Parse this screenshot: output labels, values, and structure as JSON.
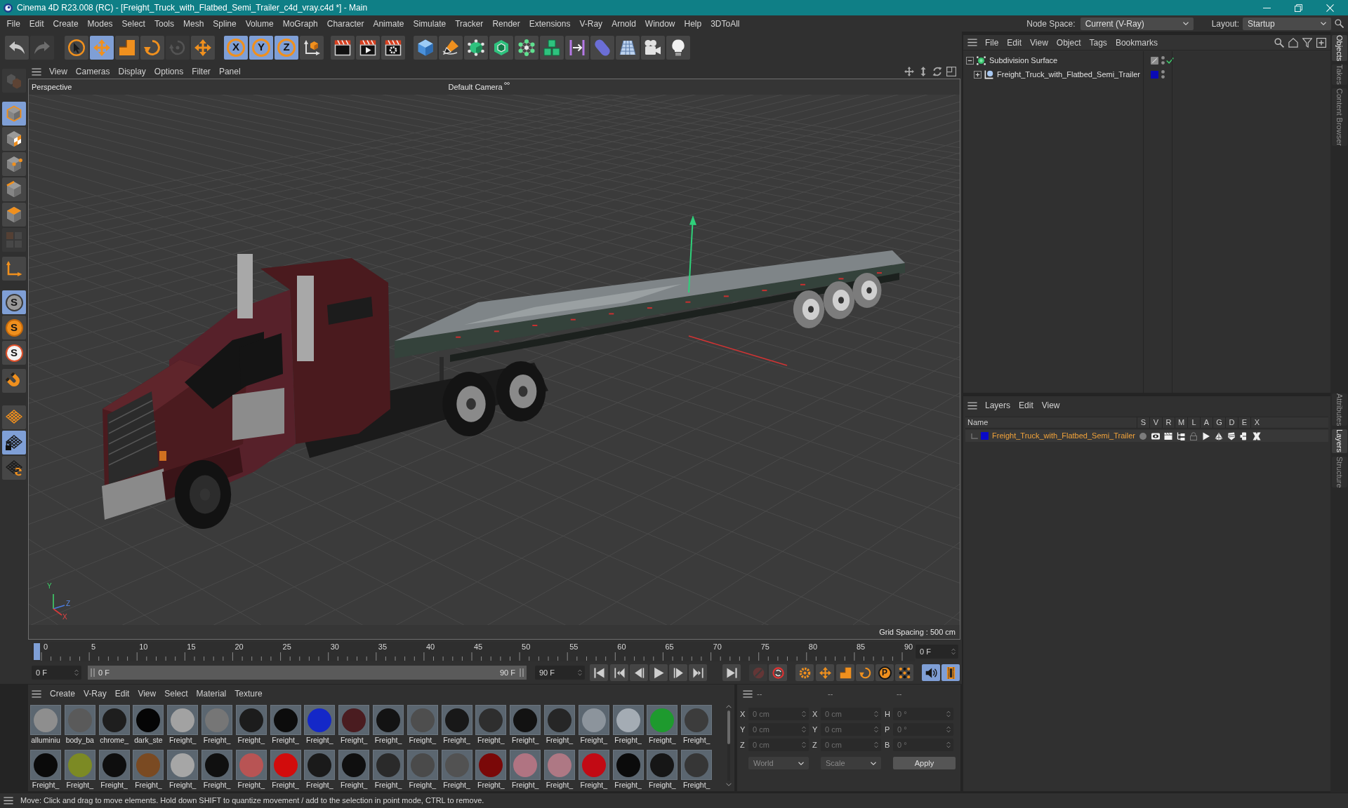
{
  "window": {
    "title": "Cinema 4D R23.008 (RC) - [Freight_Truck_with_Flatbed_Semi_Trailer_c4d_vray.c4d *] - Main"
  },
  "menu_bar": {
    "items": [
      "File",
      "Edit",
      "Create",
      "Modes",
      "Select",
      "Tools",
      "Mesh",
      "Spline",
      "Volume",
      "MoGraph",
      "Character",
      "Animate",
      "Simulate",
      "Tracker",
      "Render",
      "Extensions",
      "V-Ray",
      "Arnold",
      "Window",
      "Help",
      "3DToAll"
    ],
    "node_space": {
      "label": "Node Space:",
      "value": "Current (V-Ray)"
    },
    "layout": {
      "label": "Layout:",
      "value": "Startup"
    }
  },
  "toolbar": {
    "buttons": [
      {
        "selected": false,
        "disabled": false
      },
      {
        "selected": false,
        "disabled": true
      },
      {
        "selected": false,
        "disabled": false
      },
      {
        "selected": true,
        "disabled": false
      },
      {
        "selected": false,
        "disabled": false
      },
      {
        "selected": false,
        "disabled": false
      },
      {
        "selected": false,
        "disabled": true
      },
      {
        "selected": false,
        "disabled": false
      },
      {
        "label": "X",
        "selected": true,
        "disabled": false
      },
      {
        "label": "Y",
        "selected": true,
        "disabled": false
      },
      {
        "label": "Z",
        "selected": true,
        "disabled": false
      },
      {
        "selected": false,
        "disabled": false
      },
      {
        "selected": false,
        "disabled": false
      },
      {
        "selected": false,
        "disabled": false
      },
      {
        "selected": false,
        "disabled": false
      },
      {
        "selected": false,
        "disabled": false
      },
      {
        "selected": false,
        "disabled": false
      },
      {
        "selected": false,
        "disabled": false
      },
      {
        "selected": false,
        "disabled": false
      },
      {
        "selected": false,
        "disabled": false
      },
      {
        "selected": false,
        "disabled": false
      },
      {
        "selected": false,
        "disabled": false
      },
      {
        "selected": false,
        "disabled": false
      },
      {
        "selected": false,
        "disabled": false
      },
      {
        "selected": false,
        "disabled": false
      },
      {
        "selected": false,
        "disabled": false
      }
    ]
  },
  "left_toolbar": {
    "buttons": [
      {
        "selected": false,
        "disabled": true
      },
      {
        "selected": true,
        "disabled": false
      },
      {
        "selected": false,
        "disabled": false
      },
      {
        "selected": false,
        "disabled": false
      },
      {
        "selected": false,
        "disabled": false
      },
      {
        "selected": false,
        "disabled": false
      },
      {
        "selected": false,
        "disabled": true
      },
      {
        "selected": false,
        "disabled": false
      },
      {
        "label": "S",
        "selected": true,
        "disabled": false
      },
      {
        "label": "S",
        "selected": false,
        "disabled": false
      },
      {
        "label": "S",
        "selected": false,
        "disabled": false
      },
      {
        "selected": false,
        "disabled": false
      },
      {
        "selected": false,
        "disabled": false
      },
      {
        "selected": true,
        "disabled": false
      },
      {
        "selected": false,
        "disabled": false
      }
    ]
  },
  "viewport": {
    "menu": [
      "View",
      "Cameras",
      "Display",
      "Options",
      "Filter",
      "Panel"
    ],
    "view_name": "Perspective",
    "camera": "Default Camera",
    "grid_spacing": "Grid Spacing : 500 cm",
    "axis_labels": [
      "Y",
      "Z",
      "X"
    ]
  },
  "timeline": {
    "ticks": [
      "0",
      "5",
      "10",
      "15",
      "20",
      "25",
      "30",
      "35",
      "40",
      "45",
      "50",
      "55",
      "60",
      "65",
      "70",
      "75",
      "80",
      "85",
      "90"
    ],
    "level": 0,
    "current_frame": "0 F",
    "start_field": "0 F",
    "range_slider": {
      "start_label": "0 F",
      "end_label": "90 F",
      "level": 1
    },
    "end_field": "90 F",
    "buttons": [
      {
        "selected": false,
        "disabled": false
      },
      {
        "selected": false,
        "disabled": false
      },
      {
        "selected": false,
        "disabled": false
      },
      {
        "selected": false,
        "disabled": false
      },
      {
        "selected": false,
        "disabled": false
      },
      {
        "selected": false,
        "disabled": false
      },
      {
        "selected": false,
        "disabled": false
      },
      {
        "selected": false,
        "disabled": true
      },
      {
        "selected": false,
        "disabled": false
      },
      {
        "selected": false,
        "disabled": false
      },
      {
        "selected": false,
        "disabled": false
      },
      {
        "selected": false,
        "disabled": false
      },
      {
        "selected": false,
        "disabled": false
      },
      {
        "label": "P",
        "selected": false,
        "disabled": false
      },
      {
        "selected": false,
        "disabled": false
      },
      {
        "selected": true,
        "disabled": false
      },
      {
        "selected": true,
        "disabled": false
      }
    ]
  },
  "materials": {
    "menu": [
      "Create",
      "V-Ray",
      "Edit",
      "View",
      "Select",
      "Material",
      "Texture"
    ],
    "items": [
      {
        "name": "alluminiu",
        "color": "#8e8e8e"
      },
      {
        "name": "body_ba",
        "color": "#5a5a5a"
      },
      {
        "name": "chrome_",
        "color": "#1e1e1e"
      },
      {
        "name": "dark_ste",
        "color": "#050505"
      },
      {
        "name": "Freight_",
        "color": "#a2a2a2"
      },
      {
        "name": "Freight_",
        "color": "#767676"
      },
      {
        "name": "Freight_",
        "color": "#1c1c1c"
      },
      {
        "name": "Freight_",
        "color": "#0c0c0c"
      },
      {
        "name": "Freight_",
        "color": "#1428c8"
      },
      {
        "name": "Freight_",
        "color": "#4a1c20"
      },
      {
        "name": "Freight_",
        "color": "#131313"
      },
      {
        "name": "Freight_",
        "color": "#4e4e4e"
      },
      {
        "name": "Freight_",
        "color": "#181818"
      },
      {
        "name": "Freight_",
        "color": "#2e2e2e"
      },
      {
        "name": "Freight_",
        "color": "#121212"
      },
      {
        "name": "Freight_",
        "color": "#262626"
      },
      {
        "name": "Freight_",
        "color": "#8c949c"
      },
      {
        "name": "Freight_",
        "color": "#a4acb4"
      },
      {
        "name": "Freight_",
        "color": "#1e9a2e"
      },
      {
        "name": "Freight_",
        "color": "#3c3c3c"
      },
      {
        "name": "Freight_",
        "color": "#0a0a0a"
      },
      {
        "name": "Freight_",
        "color": "#7c8a24"
      },
      {
        "name": "Freight_",
        "color": "#0e0e0e"
      },
      {
        "name": "Freight_",
        "color": "#7a4a22"
      },
      {
        "name": "Freight_",
        "color": "#a6a6a6"
      },
      {
        "name": "Freight_",
        "color": "#101010"
      },
      {
        "name": "Freight_",
        "color": "#b85454"
      },
      {
        "name": "Freight_",
        "color": "#d20c0c"
      },
      {
        "name": "Freight_",
        "color": "#1a1a1a"
      },
      {
        "name": "Freight_",
        "color": "#0f0f0f"
      },
      {
        "name": "Freight_",
        "color": "#2a2a2a"
      },
      {
        "name": "Freight_",
        "color": "#4a4a4a"
      },
      {
        "name": "Freight_",
        "color": "#525252"
      },
      {
        "name": "Freight_",
        "color": "#7a0808"
      },
      {
        "name": "Freight_",
        "color": "#b07482"
      },
      {
        "name": "Freight_",
        "color": "#ae7884"
      },
      {
        "name": "Freight_",
        "color": "#c20a14"
      },
      {
        "name": "Freight_",
        "color": "#0b0b0b"
      },
      {
        "name": "Freight_",
        "color": "#161616"
      },
      {
        "name": "Freight_",
        "color": "#363636"
      }
    ]
  },
  "coordinates": {
    "headers": [
      "--",
      "--",
      "--"
    ],
    "disabled": true,
    "rows": [
      {
        "cells": [
          {
            "axis": "X",
            "value": "0 cm"
          },
          {
            "axis": "X",
            "value": "0 cm"
          },
          {
            "axis": "H",
            "value": "0 °"
          }
        ]
      },
      {
        "cells": [
          {
            "axis": "Y",
            "value": "0 cm"
          },
          {
            "axis": "Y",
            "value": "0 cm"
          },
          {
            "axis": "P",
            "value": "0 °"
          }
        ]
      },
      {
        "cells": [
          {
            "axis": "Z",
            "value": "0 cm"
          },
          {
            "axis": "Z",
            "value": "0 cm"
          },
          {
            "axis": "B",
            "value": "0 °"
          }
        ]
      }
    ],
    "dropdowns": [
      "World",
      "Scale"
    ],
    "apply": "Apply"
  },
  "objects": {
    "menu": [
      "File",
      "Edit",
      "View",
      "Object",
      "Tags",
      "Bookmarks"
    ],
    "tree": [
      {
        "name": "Subdivision Surface",
        "expanded": true,
        "enabled": true,
        "children": [
          {
            "name": "Freight_Truck_with_Flatbed_Semi_Trailer",
            "expanded": false,
            "color": "#0a0ab4"
          }
        ]
      }
    ]
  },
  "layers": {
    "menu": [
      "Layers",
      "Edit",
      "View"
    ],
    "columns": [
      "Name",
      "S",
      "V",
      "R",
      "M",
      "L",
      "A",
      "G",
      "D",
      "E",
      "X"
    ],
    "rows": [
      {
        "name": "Freight_Truck_with_Flatbed_Semi_Trailer",
        "color": "#0a0ac8",
        "flags": [
          {
            "on": false
          },
          {
            "on": true
          },
          {
            "on": true
          },
          {
            "on": true
          },
          {
            "on": false
          },
          {
            "on": true
          },
          {
            "on": true
          },
          {
            "on": true
          },
          {
            "on": true
          },
          {
            "on": true
          }
        ]
      }
    ]
  },
  "side_tabs_upper": [
    {
      "label": "Objects",
      "selected": true
    },
    {
      "label": "Takes",
      "selected": false
    },
    {
      "label": "Content Browser",
      "selected": false
    }
  ],
  "side_tabs_lower": [
    {
      "label": "Attributes",
      "selected": false
    },
    {
      "label": "Layers",
      "selected": true
    },
    {
      "label": "Structure",
      "selected": false
    }
  ],
  "status_bar": {
    "text": "Move: Click and drag to move elements. Hold down SHIFT to quantize movement / add to the selection in point mode, CTRL to remove."
  }
}
